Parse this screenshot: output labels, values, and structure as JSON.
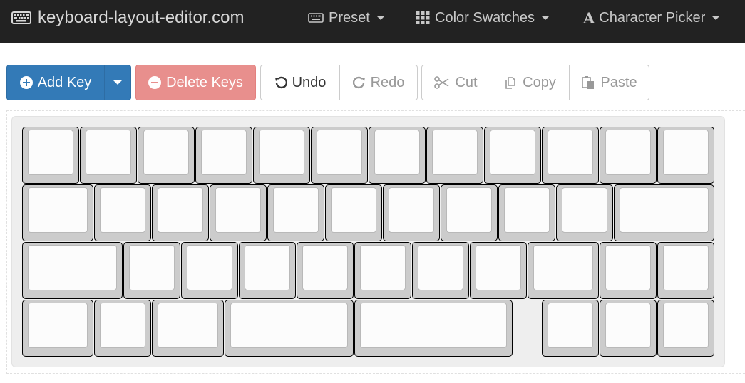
{
  "navbar": {
    "brand": "keyboard-layout-editor.com",
    "preset": "Preset",
    "color_swatches": "Color Swatches",
    "character_picker": "Character Picker"
  },
  "toolbar": {
    "add_key": "Add Key",
    "delete_keys": "Delete Keys",
    "undo": "Undo",
    "redo": "Redo",
    "cut": "Cut",
    "copy": "Copy",
    "paste": "Paste"
  },
  "colors": {
    "navbar_bg": "#222222",
    "primary": "#337ab7",
    "danger": "#e88f8d",
    "key_body": "#cccccc",
    "key_top": "#fcfcfc"
  },
  "keyboard": {
    "rows": [
      [
        1,
        1,
        1,
        1,
        1,
        1,
        1,
        1,
        1,
        1,
        1,
        1
      ],
      [
        1.25,
        1,
        1,
        1,
        1,
        1,
        1,
        1,
        1,
        1,
        1.75
      ],
      [
        1.75,
        1,
        1,
        1,
        1,
        1,
        1,
        1,
        1.25,
        1,
        1
      ],
      [
        1.25,
        1,
        1.25,
        2.25,
        2.75,
        "gap:0.5",
        1,
        1,
        1
      ]
    ]
  }
}
